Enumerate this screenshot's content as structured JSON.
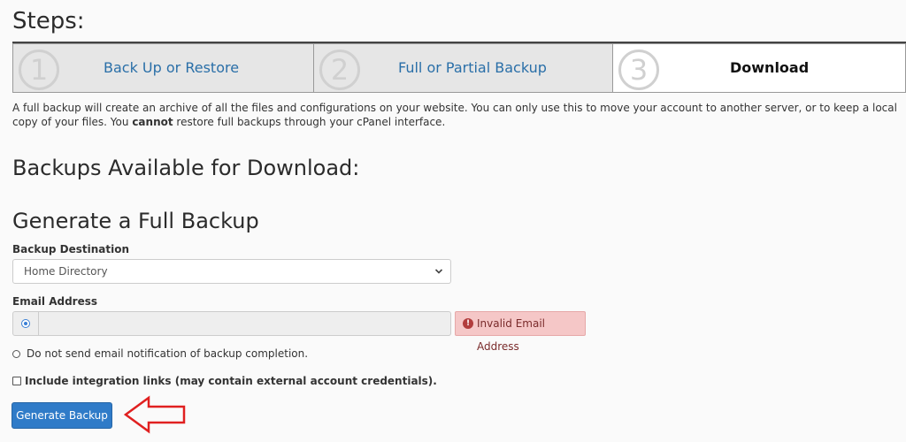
{
  "page": {
    "steps_title": "Steps:",
    "steps": [
      {
        "number": "1",
        "label": "Back Up or Restore"
      },
      {
        "number": "2",
        "label": "Full or Partial Backup"
      },
      {
        "number": "3",
        "label": "Download"
      }
    ],
    "description_part1": "A full backup will create an archive of all the files and configurations on your website. You can only use this to move your account to another server, or to keep a local copy of your files. You ",
    "description_bold": "cannot",
    "description_part2": " restore full backups through your cPanel interface.",
    "backups_heading": "Backups Available for Download:",
    "generate_heading": "Generate a Full Backup"
  },
  "form": {
    "destination_label": "Backup Destination",
    "destination_value": "Home Directory",
    "email_label": "Email Address",
    "email_value": "",
    "email_error": "Invalid Email Address",
    "no_email_label": "Do not send email notification of backup completion.",
    "integration_label": "Include integration links (may contain external account credentials).",
    "submit_label": "Generate Backup"
  },
  "icons": {
    "dropdown": "chevron-down-icon",
    "error": "exclamation-circle-icon",
    "annotation": "red-arrow-icon"
  },
  "colors": {
    "link": "#2a6fa8",
    "primary_button": "#2f7bc8",
    "error_bg": "#f5c7c7",
    "error_text": "#7a2b2b",
    "arrow": "#e02020"
  }
}
